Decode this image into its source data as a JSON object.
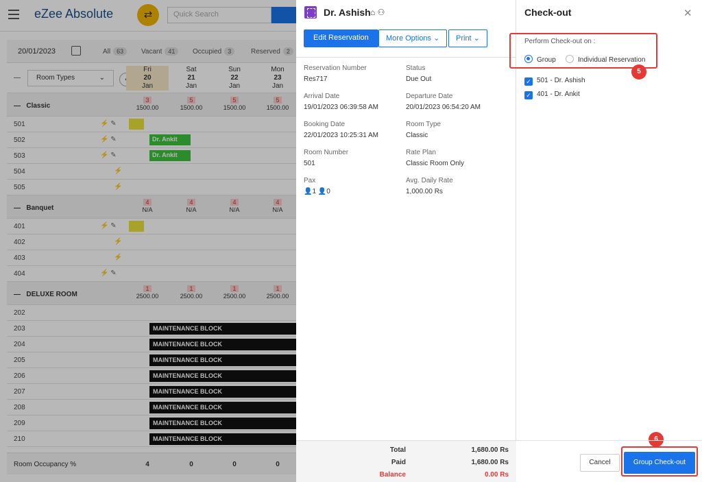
{
  "app": {
    "logo": "eZee Absolute",
    "search_placeholder": "Quick Search"
  },
  "filter": {
    "date": "20/01/2023",
    "items": [
      {
        "label": "All",
        "count": "63"
      },
      {
        "label": "Vacant",
        "count": "41"
      },
      {
        "label": "Occupied",
        "count": "3"
      },
      {
        "label": "Reserved",
        "count": "2"
      }
    ]
  },
  "grid": {
    "room_types_label": "Room Types",
    "days": [
      {
        "dow": "Fri",
        "day": "20",
        "mon": "Jan"
      },
      {
        "dow": "Sat",
        "day": "21",
        "mon": "Jan"
      },
      {
        "dow": "Sun",
        "day": "22",
        "mon": "Jan"
      },
      {
        "dow": "Mon",
        "day": "23",
        "mon": "Jan"
      }
    ],
    "classic": {
      "label": "Classic",
      "inv": [
        {
          "n": "3",
          "p": "1500.00"
        },
        {
          "n": "5",
          "p": "1500.00"
        },
        {
          "n": "5",
          "p": "1500.00"
        },
        {
          "n": "5",
          "p": "1500.00"
        }
      ],
      "rooms": [
        "501",
        "502",
        "503",
        "504",
        "505"
      ]
    },
    "banquet": {
      "label": "Banquet",
      "inv": [
        {
          "n": "4",
          "p": "N/A"
        },
        {
          "n": "4",
          "p": "N/A"
        },
        {
          "n": "4",
          "p": "N/A"
        },
        {
          "n": "4",
          "p": "N/A"
        }
      ],
      "rooms": [
        "401",
        "402",
        "403",
        "404"
      ]
    },
    "deluxe": {
      "label": "DELUXE ROOM",
      "inv": [
        {
          "n": "1",
          "p": "2500.00"
        },
        {
          "n": "1",
          "p": "2500.00"
        },
        {
          "n": "1",
          "p": "2500.00"
        },
        {
          "n": "1",
          "p": "2500.00"
        }
      ],
      "rooms": [
        "202",
        "203",
        "204",
        "205",
        "206",
        "207",
        "208",
        "209",
        "210"
      ]
    },
    "res_bar_label": "Dr. Ankit",
    "maintenance_label": "MAINTENANCE BLOCK",
    "occupancy_label": "Room Occupancy %",
    "occupancy_values": [
      "4",
      "0",
      "0",
      "0"
    ]
  },
  "reservation": {
    "guest_name": "Dr. Ashish",
    "buttons": {
      "edit": "Edit Reservation",
      "more": "More Options",
      "print": "Print"
    },
    "fields": {
      "reservation_number": {
        "label": "Reservation Number",
        "value": "Res717"
      },
      "status": {
        "label": "Status",
        "value": "Due Out"
      },
      "arrival": {
        "label": "Arrival Date",
        "value": "19/01/2023 06:39:58 AM"
      },
      "departure": {
        "label": "Departure Date",
        "value": "20/01/2023 06:54:20 AM"
      },
      "booking": {
        "label": "Booking Date",
        "value": "22/01/2023 10:25:31 AM"
      },
      "room_type": {
        "label": "Room Type",
        "value": "Classic"
      },
      "room_number": {
        "label": "Room Number",
        "value": "501"
      },
      "rate_plan": {
        "label": "Rate Plan",
        "value": "Classic Room Only"
      },
      "pax": {
        "label": "Pax",
        "adults": "1",
        "children": "0"
      },
      "adr": {
        "label": "Avg. Daily Rate",
        "value": "1,000.00 Rs"
      }
    },
    "totals": {
      "total_label": "Total",
      "total_value": "1,680.00 Rs",
      "paid_label": "Paid",
      "paid_value": "1,680.00 Rs",
      "balance_label": "Balance",
      "balance_value": "0.00 Rs"
    }
  },
  "checkout": {
    "title": "Check-out",
    "perform_label": "Perform Check-out on :",
    "options": {
      "group": "Group",
      "individual": "Individual Reservation",
      "selected": "group"
    },
    "items": [
      "501 - Dr. Ashish",
      "401 - Dr. Ankit"
    ],
    "step5": "5",
    "step6": "6",
    "cancel": "Cancel",
    "group_checkout": "Group Check-out"
  },
  "colors": {
    "accent": "#1a73e8",
    "highlight": "#e53935",
    "green": "#3ec23e",
    "brand": "#1a4f8b"
  }
}
